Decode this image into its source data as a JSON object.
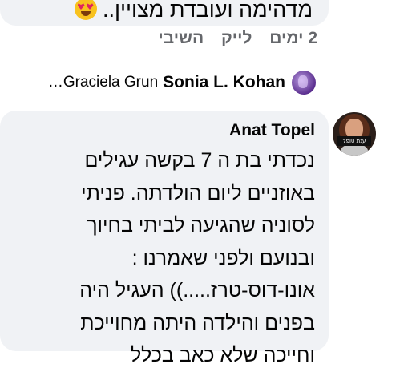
{
  "previous_comment": {
    "text_tail": "מדהימה ועובדת מצויין..",
    "emoji": "heart-eyes-emoji"
  },
  "actions": {
    "time": "2 ימים",
    "like": "לייק",
    "reply": "השיבי"
  },
  "reply_summary": {
    "name": "Sonia L. Kohan",
    "others": "Graciela Grun…"
  },
  "comment": {
    "author": "Anat Topel",
    "avatar_banner": "ענת טופל",
    "lines": [
      "נכדתי בת ה 7 בקשה עגילים",
      "באוזניים ליום הולדתה. פניתי",
      "לסוניה שהגיעה לביתי בחיוך",
      "ובנועם ולפני שאמרנו :",
      "אונו-דוס-טרז.....)) העגיל היה",
      "בפנים והילדה היתה מחוייכת",
      "וחייכה שלא כאב בכלל"
    ]
  }
}
